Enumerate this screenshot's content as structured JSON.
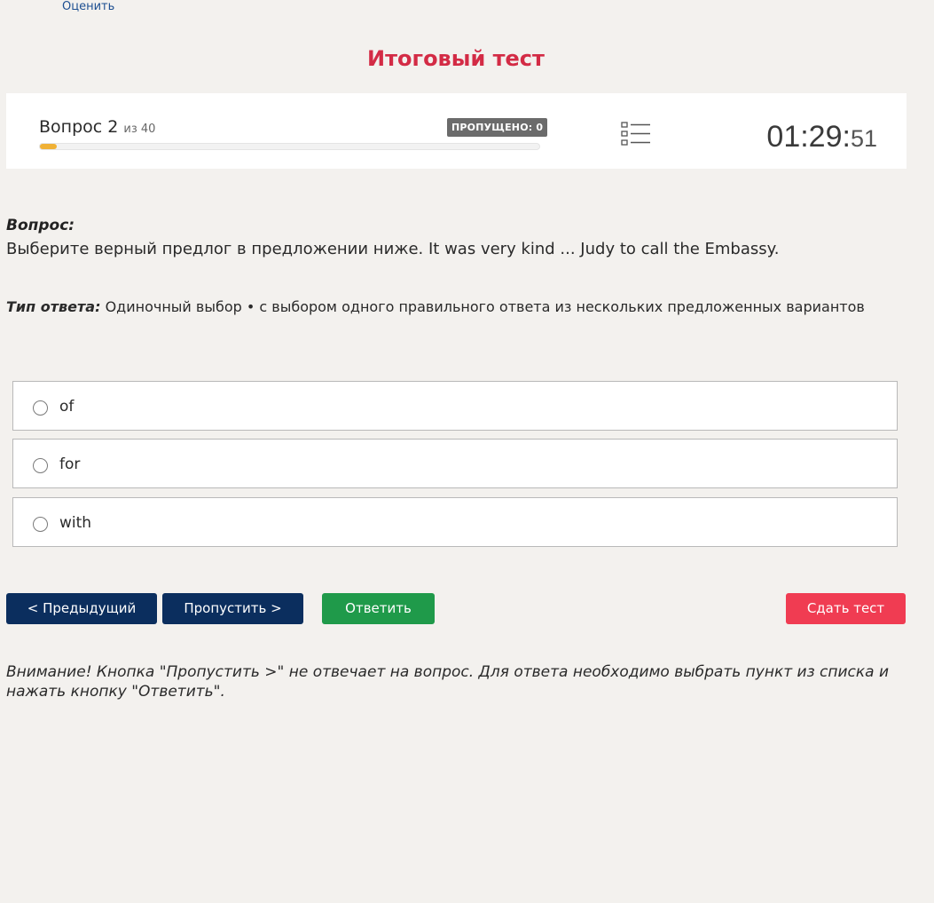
{
  "header": {
    "rate_link": "Оценить",
    "title": "Итоговый тест"
  },
  "status": {
    "question_word": "Вопрос",
    "question_number": "2",
    "of_text": "из 40",
    "skipped_label": "ПРОПУЩЕНО: 0",
    "progress_fraction": 0.033,
    "timer_hm": "01:29:",
    "timer_s": "51"
  },
  "question": {
    "label": "Вопрос:",
    "text": "Выберите верный предлог в предложении ниже. It was very kind ... Judy to call the Embassy.",
    "type_label": "Тип ответа:",
    "type_value": "Одиночный выбор • с выбором одного правильного ответа из нескольких предложенных вариантов"
  },
  "options": [
    "of",
    "for",
    "with"
  ],
  "buttons": {
    "prev": "< Предыдущий",
    "skip": "Пропустить >",
    "answer": "Ответить",
    "submit": "Сдать тест"
  },
  "notice": "Внимание! Кнопка \"Пропустить >\" не отвечает на вопрос. Для ответа необходимо выбрать пункт из списка и нажать кнопку \"Ответить\".",
  "colors": {
    "title": "#d32b45",
    "primary_button": "#0b2e5e",
    "answer_button": "#1f9a4a",
    "submit_button": "#f03c52",
    "progress": "#f0b135"
  }
}
